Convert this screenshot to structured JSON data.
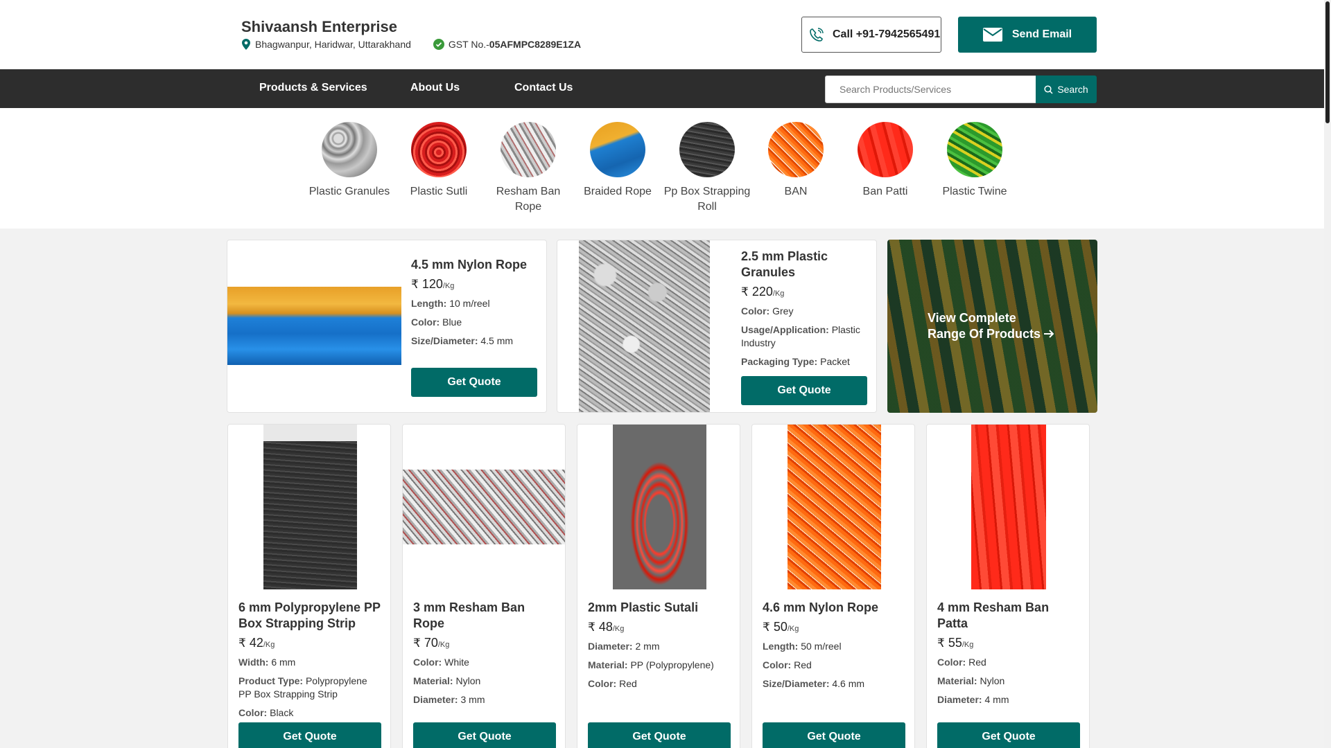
{
  "header": {
    "business_name": "Shivaansh Enterprise",
    "location": "Bhagwanpur, Haridwar, Uttarakhand",
    "gst_label": "GST No.-",
    "gst_number": "05AFMPC8289E1ZA",
    "call_label": "Call +91-7942565491",
    "email_label": "Send Email"
  },
  "nav": {
    "items": [
      "Products & Services",
      "About Us",
      "Contact Us"
    ],
    "search_placeholder": "Search Products/Services",
    "search_label": "Search"
  },
  "categories": [
    {
      "label": "Plastic Granules"
    },
    {
      "label": "Plastic Sutli"
    },
    {
      "label": "Resham Ban Rope"
    },
    {
      "label": "Braided Rope"
    },
    {
      "label": "Pp Box Strapping Roll"
    },
    {
      "label": "BAN"
    },
    {
      "label": "Ban Patti"
    },
    {
      "label": "Plastic Twine"
    }
  ],
  "currency": "₹",
  "featured": [
    {
      "title": "4.5 mm Nylon Rope",
      "price": "120",
      "unit": "/Kg",
      "specs": [
        {
          "k": "Length:",
          "v": "10 m/reel"
        },
        {
          "k": "Color:",
          "v": "Blue"
        },
        {
          "k": "Size/Diameter:",
          "v": "4.5 mm"
        }
      ],
      "cta": "Get Quote"
    },
    {
      "title": "2.5 mm Plastic Granules",
      "price": "220",
      "unit": "/Kg",
      "specs": [
        {
          "k": "Color:",
          "v": "Grey"
        },
        {
          "k": "Usage/Application:",
          "v": "Plastic Industry"
        },
        {
          "k": "Packaging Type:",
          "v": "Packet"
        }
      ],
      "cta": "Get Quote"
    }
  ],
  "view_all": {
    "line1": "View Complete",
    "line2": "Range Of Products"
  },
  "products": [
    {
      "title": "6 mm Polypropylene PP Box Strapping Strip",
      "price": "42",
      "unit": "/Kg",
      "specs": [
        {
          "k": "Width:",
          "v": "6 mm"
        },
        {
          "k": "Product Type:",
          "v": "Polypropylene PP Box Strapping Strip"
        },
        {
          "k": "Color:",
          "v": "Black"
        }
      ],
      "cta": "Get Quote"
    },
    {
      "title": "3 mm Resham Ban Rope",
      "price": "70",
      "unit": "/Kg",
      "specs": [
        {
          "k": "Color:",
          "v": "White"
        },
        {
          "k": "Material:",
          "v": "Nylon"
        },
        {
          "k": "Diameter:",
          "v": "3 mm"
        }
      ],
      "cta": "Get Quote"
    },
    {
      "title": "2mm Plastic Sutali",
      "price": "48",
      "unit": "/Kg",
      "specs": [
        {
          "k": "Diameter:",
          "v": "2 mm"
        },
        {
          "k": "Material:",
          "v": "PP (Polypropylene)"
        },
        {
          "k": "Color:",
          "v": "Red"
        }
      ],
      "cta": "Get Quote"
    },
    {
      "title": "4.6 mm Nylon Rope",
      "price": "50",
      "unit": "/Kg",
      "specs": [
        {
          "k": "Length:",
          "v": "50 m/reel"
        },
        {
          "k": "Color:",
          "v": "Red"
        },
        {
          "k": "Size/Diameter:",
          "v": "4.6 mm"
        }
      ],
      "cta": "Get Quote"
    },
    {
      "title": "4 mm Resham Ban Patta",
      "price": "55",
      "unit": "/Kg",
      "specs": [
        {
          "k": "Color:",
          "v": "Red"
        },
        {
          "k": "Material:",
          "v": "Nylon"
        },
        {
          "k": "Diameter:",
          "v": "4 mm"
        }
      ],
      "cta": "Get Quote"
    }
  ],
  "colors": {
    "accent": "#016b67",
    "nav_bg": "#2d2d2d"
  }
}
